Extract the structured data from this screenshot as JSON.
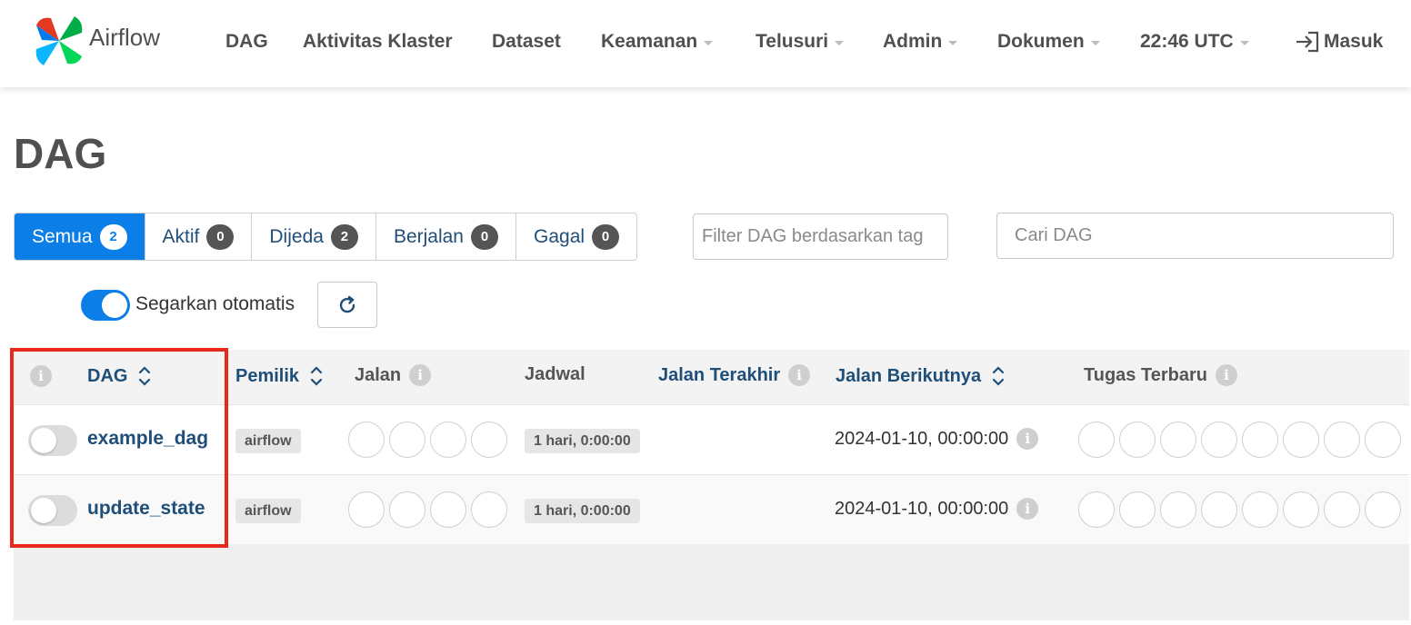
{
  "navbar": {
    "brand": "Airflow",
    "items": [
      {
        "label": "DAG",
        "dropdown": false
      },
      {
        "label": "Aktivitas Klaster",
        "dropdown": false
      },
      {
        "label": "Dataset",
        "dropdown": false
      },
      {
        "label": "Keamanan",
        "dropdown": true
      },
      {
        "label": "Telusuri",
        "dropdown": true
      },
      {
        "label": "Admin",
        "dropdown": true
      },
      {
        "label": "Dokumen",
        "dropdown": true
      },
      {
        "label": "22:46 UTC",
        "dropdown": true
      }
    ],
    "login": "Masuk"
  },
  "page": {
    "title": "DAG"
  },
  "filters": {
    "tabs": [
      {
        "label": "Semua",
        "count": "2",
        "active": true
      },
      {
        "label": "Aktif",
        "count": "0",
        "active": false
      },
      {
        "label": "Dijeda",
        "count": "2",
        "active": false
      },
      {
        "label": "Berjalan",
        "count": "0",
        "active": false
      },
      {
        "label": "Gagal",
        "count": "0",
        "active": false
      }
    ],
    "tag_placeholder": "Filter DAG berdasarkan tag",
    "search_placeholder": "Cari DAG"
  },
  "auto_refresh": {
    "label": "Segarkan otomatis",
    "enabled": true
  },
  "table": {
    "headers": {
      "dag": "DAG",
      "owner": "Pemilik",
      "runs": "Jalan",
      "schedule": "Jadwal",
      "last_run": "Jalan Terakhir",
      "next_run": "Jalan Berikutnya",
      "recent_tasks": "Tugas Terbaru"
    },
    "rows": [
      {
        "dag_id": "example_dag",
        "owner": "airflow",
        "schedule": "1 hari, 0:00:00",
        "next_run": "2024-01-10, 00:00:00",
        "paused": true
      },
      {
        "dag_id": "update_state",
        "owner": "airflow",
        "schedule": "1 hari, 0:00:00",
        "next_run": "2024-01-10, 00:00:00",
        "paused": true
      }
    ]
  },
  "colors": {
    "accent": "#0b7ee8",
    "link": "#1f4e79",
    "highlight": "#e8291a"
  }
}
